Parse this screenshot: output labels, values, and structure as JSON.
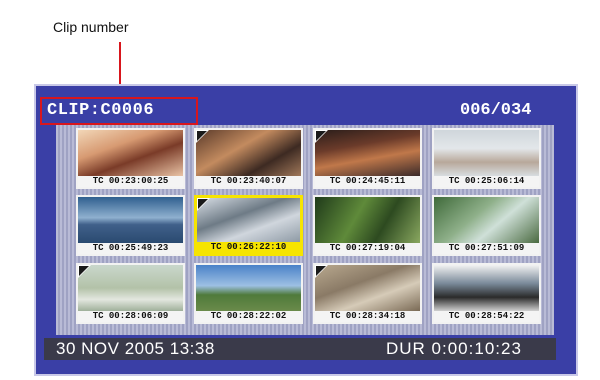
{
  "callout": {
    "label": "Clip number"
  },
  "header": {
    "clip_title": "CLIP:C0006",
    "counter": "006/034"
  },
  "thumbnails": [
    {
      "tc": "TC 00:23:00:25",
      "selected": false,
      "marker": false
    },
    {
      "tc": "TC 00:23:40:07",
      "selected": false,
      "marker": true
    },
    {
      "tc": "TC 00:24:45:11",
      "selected": false,
      "marker": true
    },
    {
      "tc": "TC 00:25:06:14",
      "selected": false,
      "marker": false
    },
    {
      "tc": "TC 00:25:49:23",
      "selected": false,
      "marker": false
    },
    {
      "tc": "TC 00:26:22:10",
      "selected": true,
      "marker": true
    },
    {
      "tc": "TC 00:27:19:04",
      "selected": false,
      "marker": false
    },
    {
      "tc": "TC 00:27:51:09",
      "selected": false,
      "marker": false
    },
    {
      "tc": "TC 00:28:06:09",
      "selected": false,
      "marker": true
    },
    {
      "tc": "TC 00:28:22:02",
      "selected": false,
      "marker": false
    },
    {
      "tc": "TC 00:28:34:18",
      "selected": false,
      "marker": true
    },
    {
      "tc": "TC 00:28:54:22",
      "selected": false,
      "marker": false
    }
  ],
  "status": {
    "date": "30 NOV 2005 13:38",
    "duration": "DUR  0:00:10:23"
  },
  "colors": {
    "screen_bg": "#3a3fa6",
    "highlight": "#f6e400",
    "callout": "#d8161d"
  }
}
